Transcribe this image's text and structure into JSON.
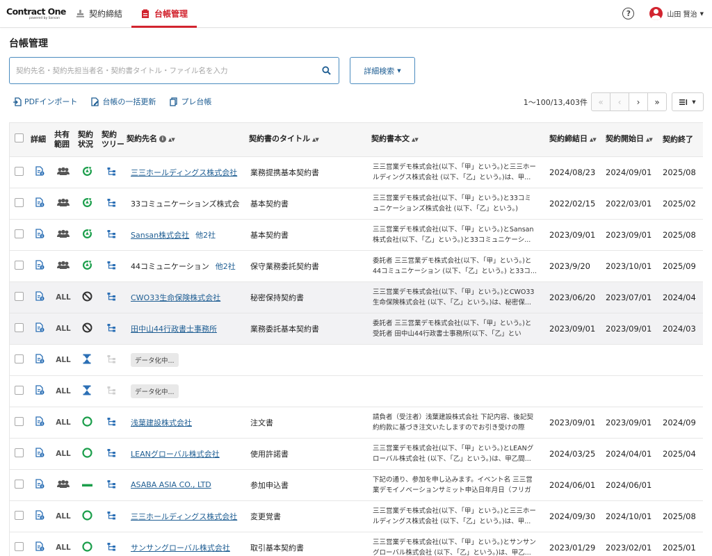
{
  "app": {
    "logo_main": "Contract One",
    "logo_sub": "powered by Sansan"
  },
  "nav": {
    "tabs": [
      {
        "label": "契約締結",
        "icon": "stamp-icon"
      },
      {
        "label": "台帳管理",
        "icon": "ledger-icon"
      }
    ],
    "user_name": "山田 賢治",
    "accent": "#d2242f"
  },
  "page": {
    "title": "台帳管理",
    "search_placeholder": "契約先名・契約先担当者名・契約書タイトル・ファイル名を入力",
    "search_value": "",
    "detail_search_label": "詳細検索"
  },
  "actions": {
    "pdf_import": "PDFインポート",
    "bulk_update": "台帳の一括更新",
    "pre_ledger": "プレ台帳"
  },
  "pager": {
    "count_label": "1〜100/13,403件"
  },
  "table": {
    "headers": {
      "detail": "詳細",
      "share_1": "共有",
      "share_2": "範囲",
      "status_1": "契約",
      "status_2": "状況",
      "tree_1": "契約",
      "tree_2": "ツリー",
      "party": "契約先名",
      "title": "契約書のタイトル",
      "body": "契約書本文",
      "signed": "契約締結日",
      "start": "契約開始日",
      "end": "契約終了"
    },
    "rows": [
      {
        "share": "group",
        "status": "renew",
        "tree": "on",
        "party": "三三ホールディングス株式会社",
        "party_link": true,
        "more": "",
        "title": "業務提携基本契約書",
        "body": "三三営業デモ株式会社(以下、「甲」という。)と三三ホールディングス株式会社 (以下、「乙」という。)は、甲...",
        "signed": "2024/08/23",
        "start": "2024/09/01",
        "end": "2025/08",
        "shaded": false
      },
      {
        "share": "group",
        "status": "renew",
        "tree": "on",
        "party": "33コミュニケーションズ株式会",
        "party_link": false,
        "more": "",
        "title": "基本契約書",
        "body": "三三営業デモ株式会社(以下、「甲」という。)と33コミュニケーションズ株式会社 (以下、「乙」という。)は、...",
        "signed": "2022/02/15",
        "start": "2022/03/01",
        "end": "2025/02",
        "shaded": false
      },
      {
        "share": "group",
        "status": "renew",
        "tree": "on",
        "party": "Sansan株式会社",
        "party_link": true,
        "more": "他2社",
        "title": "基本契約書",
        "body": "三三営業デモ株式会社(以下、「甲」という。)とSansan株式会社(以下、「乙」という。)と33コミュニケーシ...",
        "signed": "2023/09/01",
        "start": "2023/09/01",
        "end": "2025/08",
        "shaded": false
      },
      {
        "share": "group",
        "status": "renew",
        "tree": "on",
        "party": "44コミュニケーション",
        "party_link": false,
        "more": "他2社",
        "title": "保守業務委託契約書",
        "body": "委託者 三三営業デモ株式会社(以下、「甲」という。)と44コミュニケーション (以下、「乙」という。) と33コ...",
        "signed": "2023/9/20",
        "start": "2023/10/01",
        "end": "2025/09",
        "shaded": false
      },
      {
        "share": "ALL",
        "status": "cancelled",
        "tree": "on",
        "party": "CWO33生命保険株式会社",
        "party_link": true,
        "more": "",
        "title": "秘密保持契約書",
        "body": "三三営業デモ株式会社(以下、「甲」という。)とCWO33生命保険株式会社 (以下、「乙」という。)は、秘密保...",
        "signed": "2023/06/20",
        "start": "2023/07/01",
        "end": "2024/04",
        "shaded": true
      },
      {
        "share": "ALL",
        "status": "cancelled",
        "tree": "on",
        "party": "田中山44行政書士事務所",
        "party_link": true,
        "more": "",
        "title": "業務委託基本契約書",
        "body": "委託者 三三営業デモ株式会社(以下、「甲」という。)と受託者 田中山44行政書士事務所(以下、「乙」という。)...",
        "signed": "2023/09/01",
        "start": "2023/09/01",
        "end": "2024/03",
        "shaded": true
      },
      {
        "share": "ALL",
        "status": "pending",
        "tree": "off",
        "party": "",
        "badge": "データ化中...",
        "title": "",
        "body": "",
        "signed": "",
        "start": "",
        "end": "",
        "shaded": false
      },
      {
        "share": "ALL",
        "status": "pending",
        "tree": "off",
        "party": "",
        "badge": "データ化中...",
        "title": "",
        "body": "",
        "signed": "",
        "start": "",
        "end": "",
        "shaded": false
      },
      {
        "share": "ALL",
        "status": "active",
        "tree": "on",
        "party": "浅葉建設株式会社",
        "party_link": true,
        "more": "",
        "title": "注文書",
        "body": "請負者（受注者）浅葉建設株式会社 下記内容、後記契約約款に基づき注文いたしますのでお引き受けの際は、...",
        "signed": "2023/09/01",
        "start": "2023/09/01",
        "end": "2024/09",
        "shaded": false
      },
      {
        "share": "ALL",
        "status": "active",
        "tree": "on",
        "party": "LEANグローバル株式会社",
        "party_link": true,
        "more": "",
        "title": "使用許諾書",
        "body": "三三営業デモ株式会社(以下、「甲」という。)とLEANグローバル株式会社 (以下、「乙」という。)は、甲乙間...",
        "signed": "2024/03/25",
        "start": "2024/04/01",
        "end": "2025/04",
        "shaded": false
      },
      {
        "share": "group",
        "status": "none",
        "tree": "on",
        "party": "ASABA ASIA CO., LTD",
        "party_link": true,
        "more": "",
        "title": "参加申込書",
        "body": "下記の通り、参加を申し込みます。イベント名 三三営業デモイノベーションサミット申込日年月日（フリガナ...",
        "signed": "2024/06/01",
        "start": "2024/06/01",
        "end": "",
        "shaded": false
      },
      {
        "share": "ALL",
        "status": "active",
        "tree": "on",
        "party": "三三ホールディングス株式会社",
        "party_link": true,
        "more": "",
        "title": "変更覚書",
        "body": "三三営業デモ株式会社(以下、「甲」という。)と三三ホールディングス株式会社 (以下、「乙」という。)は、甲...",
        "signed": "2024/09/30",
        "start": "2024/10/01",
        "end": "2025/08",
        "shaded": false
      },
      {
        "share": "ALL",
        "status": "active",
        "tree": "on",
        "party": "サンサングローバル株式会社",
        "party_link": true,
        "more": "",
        "title": "取引基本契約書",
        "body": "三三営業デモ株式会社(以下、「甲」という。)とサンサングローバル株式会社 (以下、「乙」という。)は、甲乙...",
        "signed": "2023/01/29",
        "start": "2023/02/01",
        "end": "2025/01",
        "shaded": false
      }
    ]
  },
  "colors": {
    "link": "#1f5e93",
    "status_green": "#1b9e4b",
    "status_blue": "#2b6fb5",
    "tree_blue": "#2b6fb5"
  }
}
